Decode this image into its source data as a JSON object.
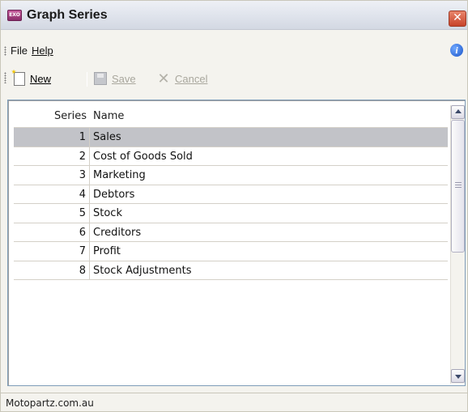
{
  "window": {
    "title": "Graph Series",
    "app_icon_text": "EXO"
  },
  "menu": {
    "items": [
      "File",
      "Help"
    ]
  },
  "toolbar": {
    "new_label": "New",
    "save_label": "Save",
    "cancel_label": "Cancel"
  },
  "grid": {
    "columns": [
      "Series",
      "Name"
    ],
    "rows": [
      {
        "series": "1",
        "name": "Sales",
        "selected": true
      },
      {
        "series": "2",
        "name": "Cost of Goods Sold"
      },
      {
        "series": "3",
        "name": "Marketing"
      },
      {
        "series": "4",
        "name": "Debtors"
      },
      {
        "series": "5",
        "name": "Stock"
      },
      {
        "series": "6",
        "name": "Creditors"
      },
      {
        "series": "7",
        "name": "Profit"
      },
      {
        "series": "8",
        "name": "Stock Adjustments"
      }
    ]
  },
  "status": {
    "text": "Motopartz.com.au"
  },
  "icons": {
    "app": "exo-app-icon",
    "close": "close-icon",
    "info": "info-icon",
    "new": "new-document-icon",
    "save": "save-disk-icon",
    "cancel": "cancel-x-icon"
  },
  "colors": {
    "selected_row": "#c2c3c8",
    "close_button": "#d4533a",
    "info_icon": "#1b55c8"
  }
}
